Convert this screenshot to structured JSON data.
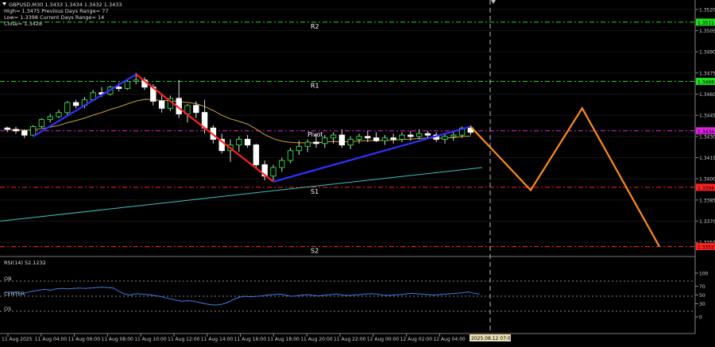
{
  "header": {
    "symbol_line": "GBPUSD,M30  1.3433 1.3434 1.3432 1.3433",
    "line2": "High= 1.3475    Previous Days Range= 77",
    "line3": "Low= 1.3398    Current Days Range= 14",
    "line4": "Close= 1.3428"
  },
  "pivots": {
    "r2": {
      "label": "R2",
      "price": 1.3511,
      "price_label": "1.3511",
      "color": "#22dd22"
    },
    "r1": {
      "label": "R1",
      "price": 1.3469,
      "price_label": "1.3469",
      "color": "#22dd22"
    },
    "pivot": {
      "label": "Pivot",
      "price": 1.3434,
      "price_label": "1.3434",
      "color": "#dd22dd"
    },
    "s1": {
      "label": "S1",
      "price": 1.3394,
      "price_label": "1.3394",
      "color": "#ff2222"
    },
    "s2": {
      "label": "S2",
      "price": 1.3352,
      "price_label": "1.3352",
      "color": "#ff2222"
    }
  },
  "price_axis": {
    "ticks": [
      "1.3520",
      "1.3505",
      "1.3490",
      "1.3475",
      "1.3460",
      "1.3445",
      "1.3430",
      "1.3415",
      "1.3400",
      "1.3385",
      "1.3370",
      "1.3355"
    ]
  },
  "time_axis": {
    "labels": [
      "11 Aug 2025",
      "11 Aug 04:00",
      "11 Aug 06:00",
      "11 Aug 08:00",
      "11 Aug 10:00",
      "11 Aug 12:00",
      "11 Aug 14:00",
      "11 Aug 16:00",
      "11 Aug 18:00",
      "11 Aug 20:00",
      "11 Aug 22:00",
      "12 Aug 00:00",
      "12 Aug 02:00",
      "12 Aug 04:00"
    ],
    "cursor_label": "2025.08.12 07:00"
  },
  "rsi": {
    "title": "RSI(14) 52.1232",
    "level_labels": {
      "ob": "OB",
      "center": "CENTER",
      "os": "OS"
    },
    "ticks": [
      "100",
      "70",
      "50",
      "30",
      "0"
    ],
    "values": [
      55,
      57,
      55,
      53,
      56,
      59,
      61,
      63,
      61,
      64,
      65,
      64,
      65,
      66,
      65,
      66,
      67,
      68,
      67,
      66,
      58,
      52,
      50,
      53,
      52,
      51,
      49,
      47,
      44,
      41,
      38,
      36,
      37,
      36,
      33,
      30,
      28,
      27,
      29,
      33,
      40,
      45,
      47,
      46,
      47,
      48,
      50,
      51,
      52,
      50,
      47,
      48,
      50,
      51,
      49,
      48,
      50,
      51,
      52,
      50,
      49,
      50,
      51,
      52,
      53,
      52,
      50,
      49,
      50,
      51,
      52,
      54,
      53,
      52,
      51,
      50,
      51,
      52,
      53,
      54,
      55,
      57,
      54,
      52
    ]
  },
  "chart_data": {
    "type": "candlestick",
    "title": "GBPUSD,M30",
    "x_range": [
      "11 Aug 2025",
      "12 Aug 2025 05:00"
    ],
    "ylim": [
      1.3345,
      1.3525
    ],
    "candles": [
      [
        1.3436,
        1.3437,
        1.3433,
        1.3435
      ],
      [
        1.3435,
        1.3437,
        1.3432,
        1.3434
      ],
      [
        1.3434,
        1.3435,
        1.3429,
        1.3431
      ],
      [
        1.3431,
        1.3438,
        1.343,
        1.3437
      ],
      [
        1.3437,
        1.3443,
        1.3436,
        1.3442
      ],
      [
        1.3442,
        1.3446,
        1.344,
        1.3444
      ],
      [
        1.3444,
        1.3449,
        1.3443,
        1.3447
      ],
      [
        1.3447,
        1.3455,
        1.3445,
        1.3454
      ],
      [
        1.3454,
        1.3456,
        1.345,
        1.3452
      ],
      [
        1.3452,
        1.3458,
        1.345,
        1.3456
      ],
      [
        1.3456,
        1.3463,
        1.3455,
        1.3461
      ],
      [
        1.3461,
        1.3465,
        1.3458,
        1.346
      ],
      [
        1.346,
        1.3466,
        1.3459,
        1.3465
      ],
      [
        1.3465,
        1.3468,
        1.3462,
        1.3464
      ],
      [
        1.3464,
        1.3471,
        1.3463,
        1.3469
      ],
      [
        1.3469,
        1.3475,
        1.3467,
        1.347
      ],
      [
        1.347,
        1.3472,
        1.3463,
        1.3465
      ],
      [
        1.3465,
        1.3467,
        1.3452,
        1.3455
      ],
      [
        1.3455,
        1.346,
        1.3447,
        1.345
      ],
      [
        1.345,
        1.3459,
        1.3448,
        1.3457
      ],
      [
        1.3457,
        1.347,
        1.3443,
        1.3446
      ],
      [
        1.3446,
        1.3453,
        1.344,
        1.3452
      ],
      [
        1.3452,
        1.3455,
        1.3443,
        1.3447
      ],
      [
        1.3447,
        1.3456,
        1.3432,
        1.3436
      ],
      [
        1.3436,
        1.3438,
        1.3425,
        1.3428
      ],
      [
        1.3428,
        1.3432,
        1.3418,
        1.342
      ],
      [
        1.342,
        1.3428,
        1.3412,
        1.3424
      ],
      [
        1.3424,
        1.343,
        1.3419,
        1.3428
      ],
      [
        1.3428,
        1.3431,
        1.3422,
        1.3424
      ],
      [
        1.3424,
        1.3425,
        1.3408,
        1.341
      ],
      [
        1.341,
        1.3413,
        1.3399,
        1.3402
      ],
      [
        1.3402,
        1.341,
        1.3399,
        1.3408
      ],
      [
        1.3408,
        1.3415,
        1.3405,
        1.3413
      ],
      [
        1.3413,
        1.3422,
        1.3411,
        1.342
      ],
      [
        1.342,
        1.3427,
        1.3417,
        1.3423
      ],
      [
        1.3423,
        1.3428,
        1.3419,
        1.3426
      ],
      [
        1.3426,
        1.3432,
        1.3422,
        1.3425
      ],
      [
        1.3425,
        1.3431,
        1.3422,
        1.3429
      ],
      [
        1.3429,
        1.3433,
        1.3425,
        1.3431
      ],
      [
        1.3431,
        1.3435,
        1.3422,
        1.3424
      ],
      [
        1.3424,
        1.343,
        1.3421,
        1.3428
      ],
      [
        1.3428,
        1.3432,
        1.3425,
        1.343
      ],
      [
        1.343,
        1.3434,
        1.3426,
        1.3429
      ],
      [
        1.3429,
        1.3433,
        1.3426,
        1.3427
      ],
      [
        1.3427,
        1.3431,
        1.3424,
        1.3429
      ],
      [
        1.3429,
        1.3432,
        1.3425,
        1.3428
      ],
      [
        1.3428,
        1.3433,
        1.3426,
        1.3431
      ],
      [
        1.3431,
        1.3434,
        1.3427,
        1.343
      ],
      [
        1.343,
        1.3435,
        1.3428,
        1.3432
      ],
      [
        1.3432,
        1.3434,
        1.3429,
        1.3431
      ],
      [
        1.3431,
        1.3433,
        1.3426,
        1.3428
      ],
      [
        1.3428,
        1.3432,
        1.3425,
        1.343
      ],
      [
        1.343,
        1.3433,
        1.3427,
        1.3431
      ],
      [
        1.3431,
        1.3437,
        1.3429,
        1.3436
      ],
      [
        1.3436,
        1.3438,
        1.3431,
        1.3433
      ]
    ],
    "ma_slow": {
      "from": 1.337,
      "to": 1.3408,
      "color": "#40c0c0"
    },
    "ma_fast_color": "#c8a040",
    "trendlines": [
      {
        "from": [
          3,
          1.343
        ],
        "to": [
          15,
          1.3474
        ],
        "color": "#3030ff"
      },
      {
        "from": [
          15,
          1.3474
        ],
        "to": [
          31,
          1.3398
        ],
        "color": "#ff2020"
      },
      {
        "from": [
          31,
          1.3398
        ],
        "to": [
          54,
          1.3437
        ],
        "color": "#3030ff"
      }
    ],
    "projection": {
      "color": "#ff8c1a",
      "points": [
        [
          54,
          1.3437
        ],
        [
          61,
          1.3392
        ],
        [
          67,
          1.345
        ],
        [
          76,
          1.3352
        ]
      ]
    }
  }
}
